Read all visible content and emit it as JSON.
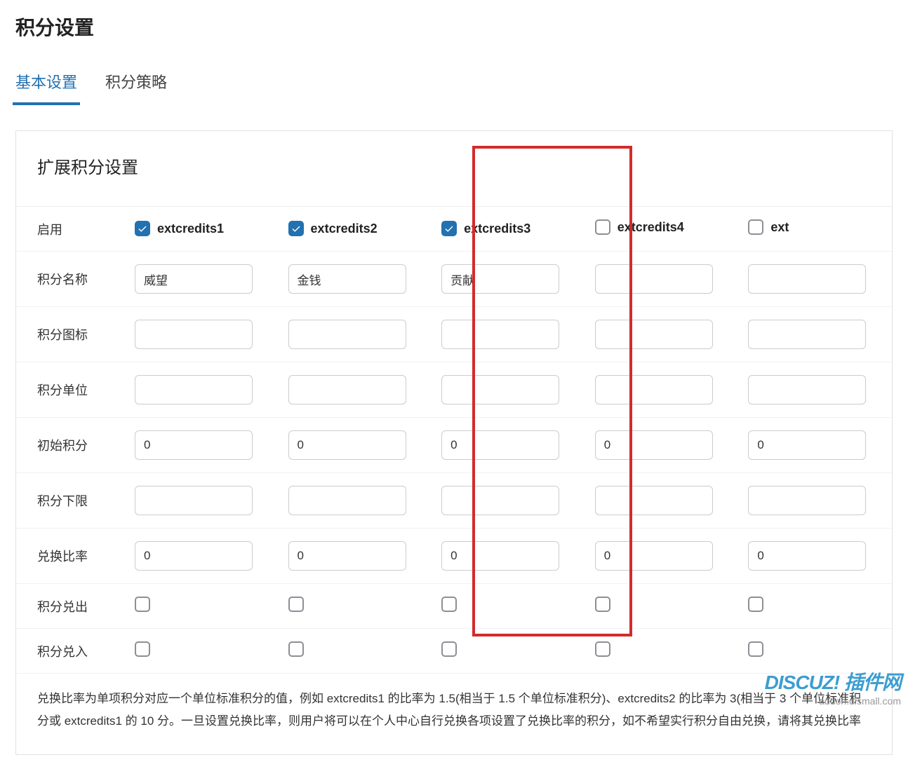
{
  "page": {
    "title": "积分设置"
  },
  "tabs": {
    "basic": "基本设置",
    "policy": "积分策略"
  },
  "section": {
    "title": "扩展积分设置"
  },
  "rows": {
    "enable": "启用",
    "name": "积分名称",
    "icon": "积分图标",
    "unit": "积分单位",
    "initial": "初始积分",
    "lower": "积分下限",
    "ratio": "兑换比率",
    "out": "积分兑出",
    "in": "积分兑入"
  },
  "columns": {
    "c1": {
      "label": "extcredits1",
      "enabled": true,
      "name": "威望",
      "icon": "",
      "unit": "",
      "initial": "0",
      "lower": "",
      "ratio": "0",
      "out": false,
      "in": false
    },
    "c2": {
      "label": "extcredits2",
      "enabled": true,
      "name": "金钱",
      "icon": "",
      "unit": "",
      "initial": "0",
      "lower": "",
      "ratio": "0",
      "out": false,
      "in": false
    },
    "c3": {
      "label": "extcredits3",
      "enabled": true,
      "name": "贡献",
      "icon": "",
      "unit": "",
      "initial": "0",
      "lower": "",
      "ratio": "0",
      "out": false,
      "in": false
    },
    "c4": {
      "label": "extcredits4",
      "enabled": false,
      "name": "",
      "icon": "",
      "unit": "",
      "initial": "0",
      "lower": "",
      "ratio": "0",
      "out": false,
      "in": false
    },
    "c5": {
      "label": "ext",
      "enabled": false,
      "name": "",
      "icon": "",
      "unit": "",
      "initial": "0",
      "lower": "",
      "ratio": "0",
      "out": false,
      "in": false
    }
  },
  "footnote": "兑换比率为单项积分对应一个单位标准积分的值，例如 extcredits1 的比率为 1.5(相当于 1.5 个单位标准积分)、extcredits2 的比率为 3(相当于 3 个单位标准积分或 extcredits1 的 10 分。一旦设置兑换比率，则用户将可以在个人中心自行兑换各项设置了兑换比率的积分，如不希望实行积分自由兑换，请将其兑换比率",
  "watermark": {
    "line1": "DISCUZ! 插件网",
    "line2": "addon.dismall.com"
  }
}
